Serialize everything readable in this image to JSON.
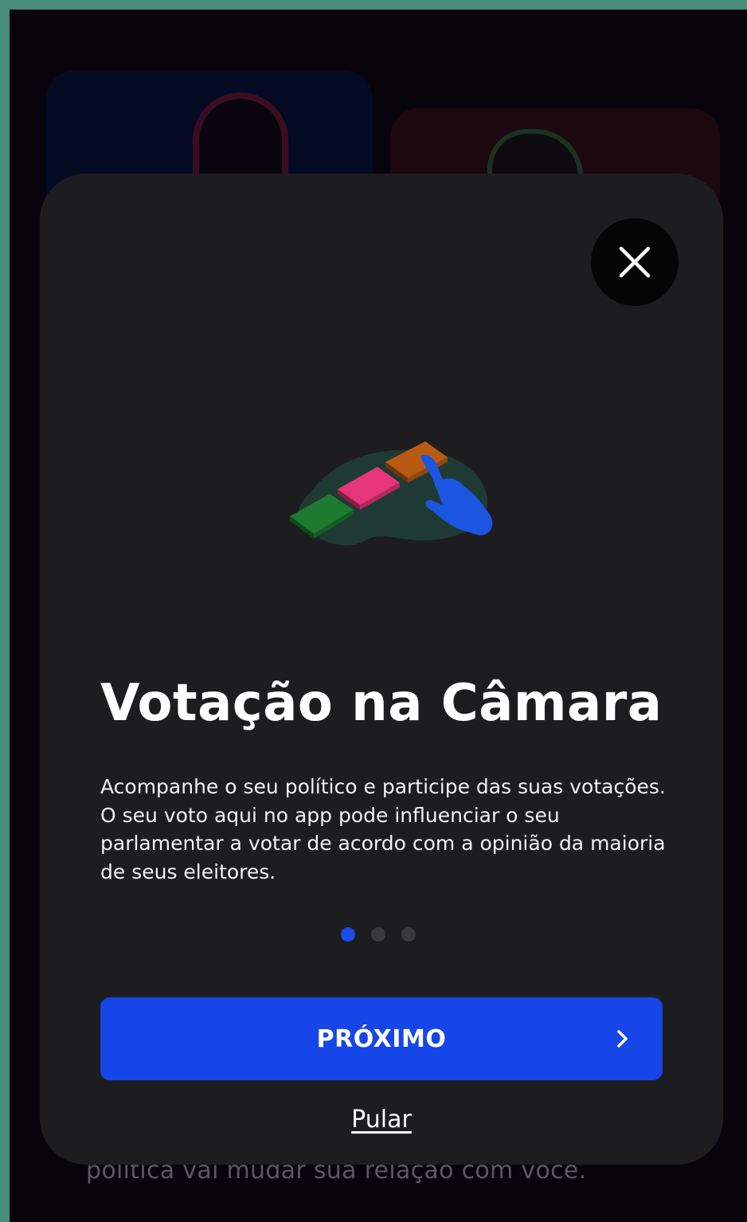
{
  "modal": {
    "title": "Votação na Câmara",
    "description": "Acompanhe o seu político e participe das suas votações. O seu voto aqui no app pode influenciar o seu parlamentar a votar de acordo com a opinião da maioria de seus eleitores.",
    "close_icon": "close-icon",
    "illustration": "voting-buttons-hand-illustration",
    "pagination": {
      "total": 3,
      "current": 1
    },
    "next_button_label": "PRÓXIMO",
    "next_icon": "chevron-right-icon",
    "skip_label": "Pular"
  },
  "background": {
    "footer_text": "política vai mudar sua relação com você."
  },
  "colors": {
    "accent": "#1746e8",
    "modal_bg": "#1d1d1f",
    "dot_inactive": "#3a3a3c"
  }
}
